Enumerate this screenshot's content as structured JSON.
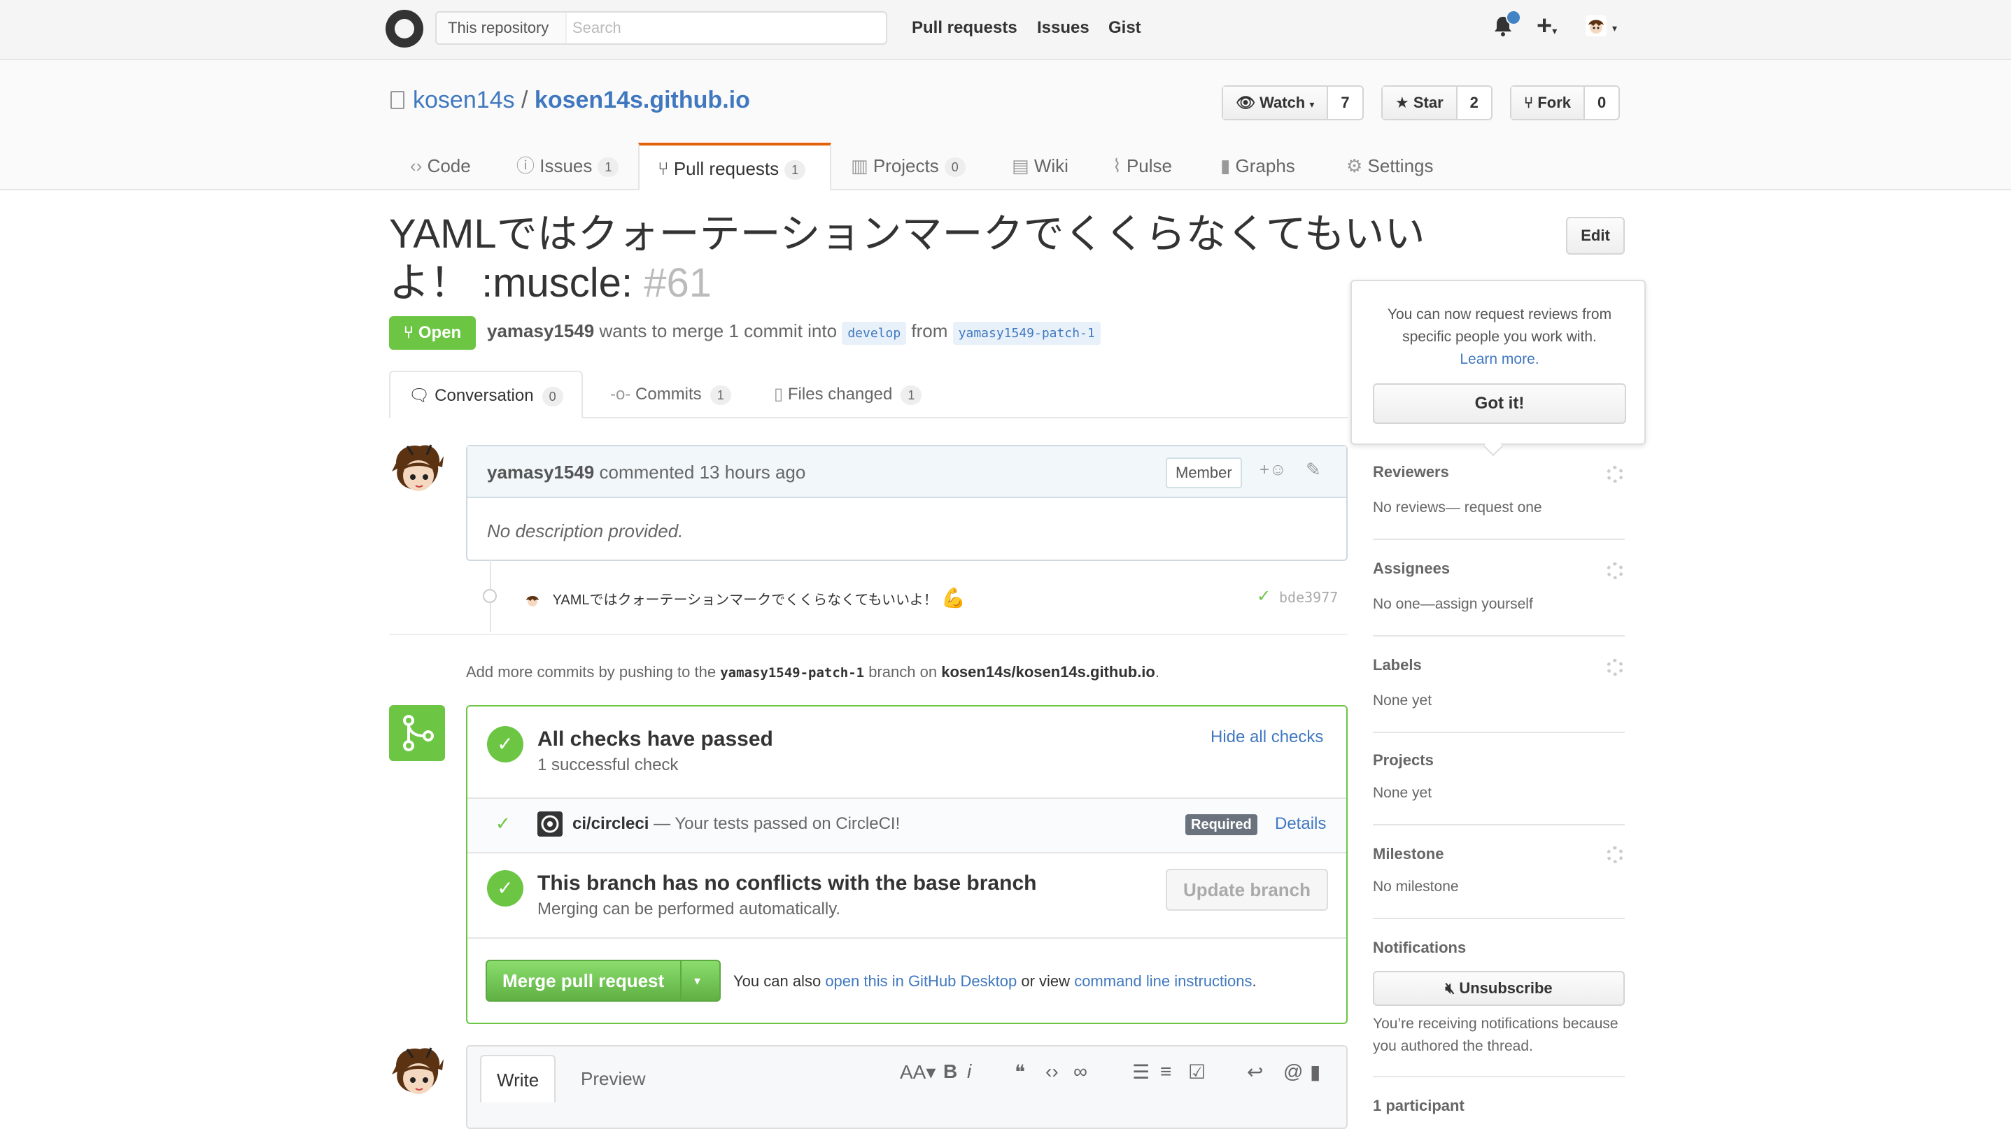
{
  "header": {
    "search_scope": "This repository",
    "search_placeholder": "Search",
    "nav": [
      "Pull requests",
      "Issues",
      "Gist"
    ]
  },
  "repo": {
    "owner": "kosen14s",
    "separator": "/",
    "name": "kosen14s.github.io",
    "watch_label": "Watch",
    "watch_count": "7",
    "star_label": "Star",
    "star_count": "2",
    "fork_label": "Fork",
    "fork_count": "0",
    "tabs": [
      {
        "label": "Code",
        "count": ""
      },
      {
        "label": "Issues",
        "count": "1"
      },
      {
        "label": "Pull requests",
        "count": "1"
      },
      {
        "label": "Projects",
        "count": "0"
      },
      {
        "label": "Wiki",
        "count": ""
      },
      {
        "label": "Pulse",
        "count": ""
      },
      {
        "label": "Graphs",
        "count": ""
      },
      {
        "label": "Settings",
        "count": ""
      }
    ]
  },
  "pr": {
    "title": "YAMLではクォーテーションマークでくくらなくてもいいよ！ :muscle:",
    "number": "#61",
    "edit_label": "Edit",
    "state": "Open",
    "author": "yamasy1549",
    "merge_text": "wants to merge 1 commit into",
    "base_branch": "develop",
    "from_text": "from",
    "head_branch": "yamasy1549-patch-1",
    "subtabs": [
      {
        "label": "Conversation",
        "count": "0"
      },
      {
        "label": "Commits",
        "count": "1"
      },
      {
        "label": "Files changed",
        "count": "1"
      }
    ]
  },
  "comment": {
    "author": "yamasy1549",
    "time_text": "commented 13 hours ago",
    "role": "Member",
    "body": "No description provided."
  },
  "commit": {
    "message": "YAMLではクォーテーションマークでくくらなくてもいいよ！",
    "emoji": "💪",
    "sha": "bde3977"
  },
  "addmore": {
    "prefix": "Add more commits by pushing to the",
    "branch": "yamasy1549-patch-1",
    "middle": "branch on",
    "repo": "kosen14s/kosen14s.github.io",
    "suffix": "."
  },
  "checks": {
    "title": "All checks have passed",
    "subtitle": "1 successful check",
    "hide_label": "Hide all checks",
    "ci_name": "ci/circleci",
    "ci_desc": "— Your tests passed on CircleCI!",
    "required": "Required",
    "details": "Details",
    "conflict_title": "This branch has no conflicts with the base branch",
    "conflict_sub": "Merging can be performed automatically.",
    "update_label": "Update branch",
    "merge_label": "Merge pull request",
    "also_text": "You can also",
    "desktop_link": "open this in GitHub Desktop",
    "or_view": "or view",
    "cli_link": "command line instructions",
    "end": "."
  },
  "editor": {
    "write": "Write",
    "preview": "Preview"
  },
  "sidebar": {
    "popover_text": "You can now request reviews from specific people you work with.",
    "learn_more": "Learn more.",
    "got_it": "Got it!",
    "reviewers_h": "Reviewers",
    "reviewers_v": "No reviews— request one",
    "assignees_h": "Assignees",
    "assignees_v": "No one—assign yourself",
    "labels_h": "Labels",
    "labels_v": "None yet",
    "projects_h": "Projects",
    "projects_v": "None yet",
    "milestone_h": "Milestone",
    "milestone_v": "No milestone",
    "notifications_h": "Notifications",
    "unsubscribe": "Unsubscribe",
    "notif_reason": "You’re receiving notifications because you authored the thread.",
    "participants": "1 participant"
  },
  "colors": {
    "green": "#6cc644",
    "link": "#4078c0",
    "tab_accent": "#e36209"
  }
}
